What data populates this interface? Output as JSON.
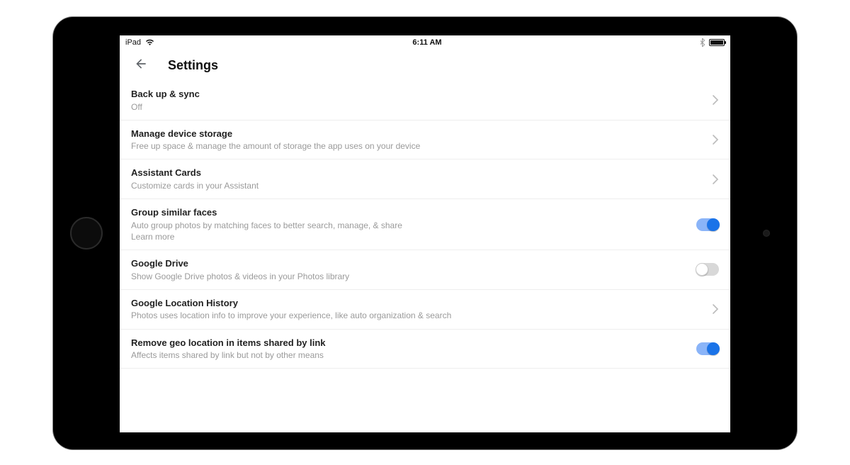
{
  "status": {
    "carrier": "iPad",
    "time": "6:11 AM"
  },
  "header": {
    "title": "Settings"
  },
  "rows": {
    "backup": {
      "title": "Back up & sync",
      "sub": "Off"
    },
    "storage": {
      "title": "Manage device storage",
      "sub": "Free up space & manage the amount of storage the app uses on your device"
    },
    "assistant": {
      "title": "Assistant Cards",
      "sub": "Customize cards in your Assistant"
    },
    "faces": {
      "title": "Group similar faces",
      "sub": "Auto group photos by matching faces to better search, manage, & share",
      "learn": "Learn more",
      "toggle": true
    },
    "drive": {
      "title": "Google Drive",
      "sub": "Show Google Drive photos & videos in your Photos library",
      "toggle": false
    },
    "location": {
      "title": "Google Location History",
      "sub": "Photos uses location info to improve your experience, like auto organization & search"
    },
    "geo": {
      "title": "Remove geo location in items shared by link",
      "sub": "Affects items shared by link but not by other means",
      "toggle": true
    }
  }
}
